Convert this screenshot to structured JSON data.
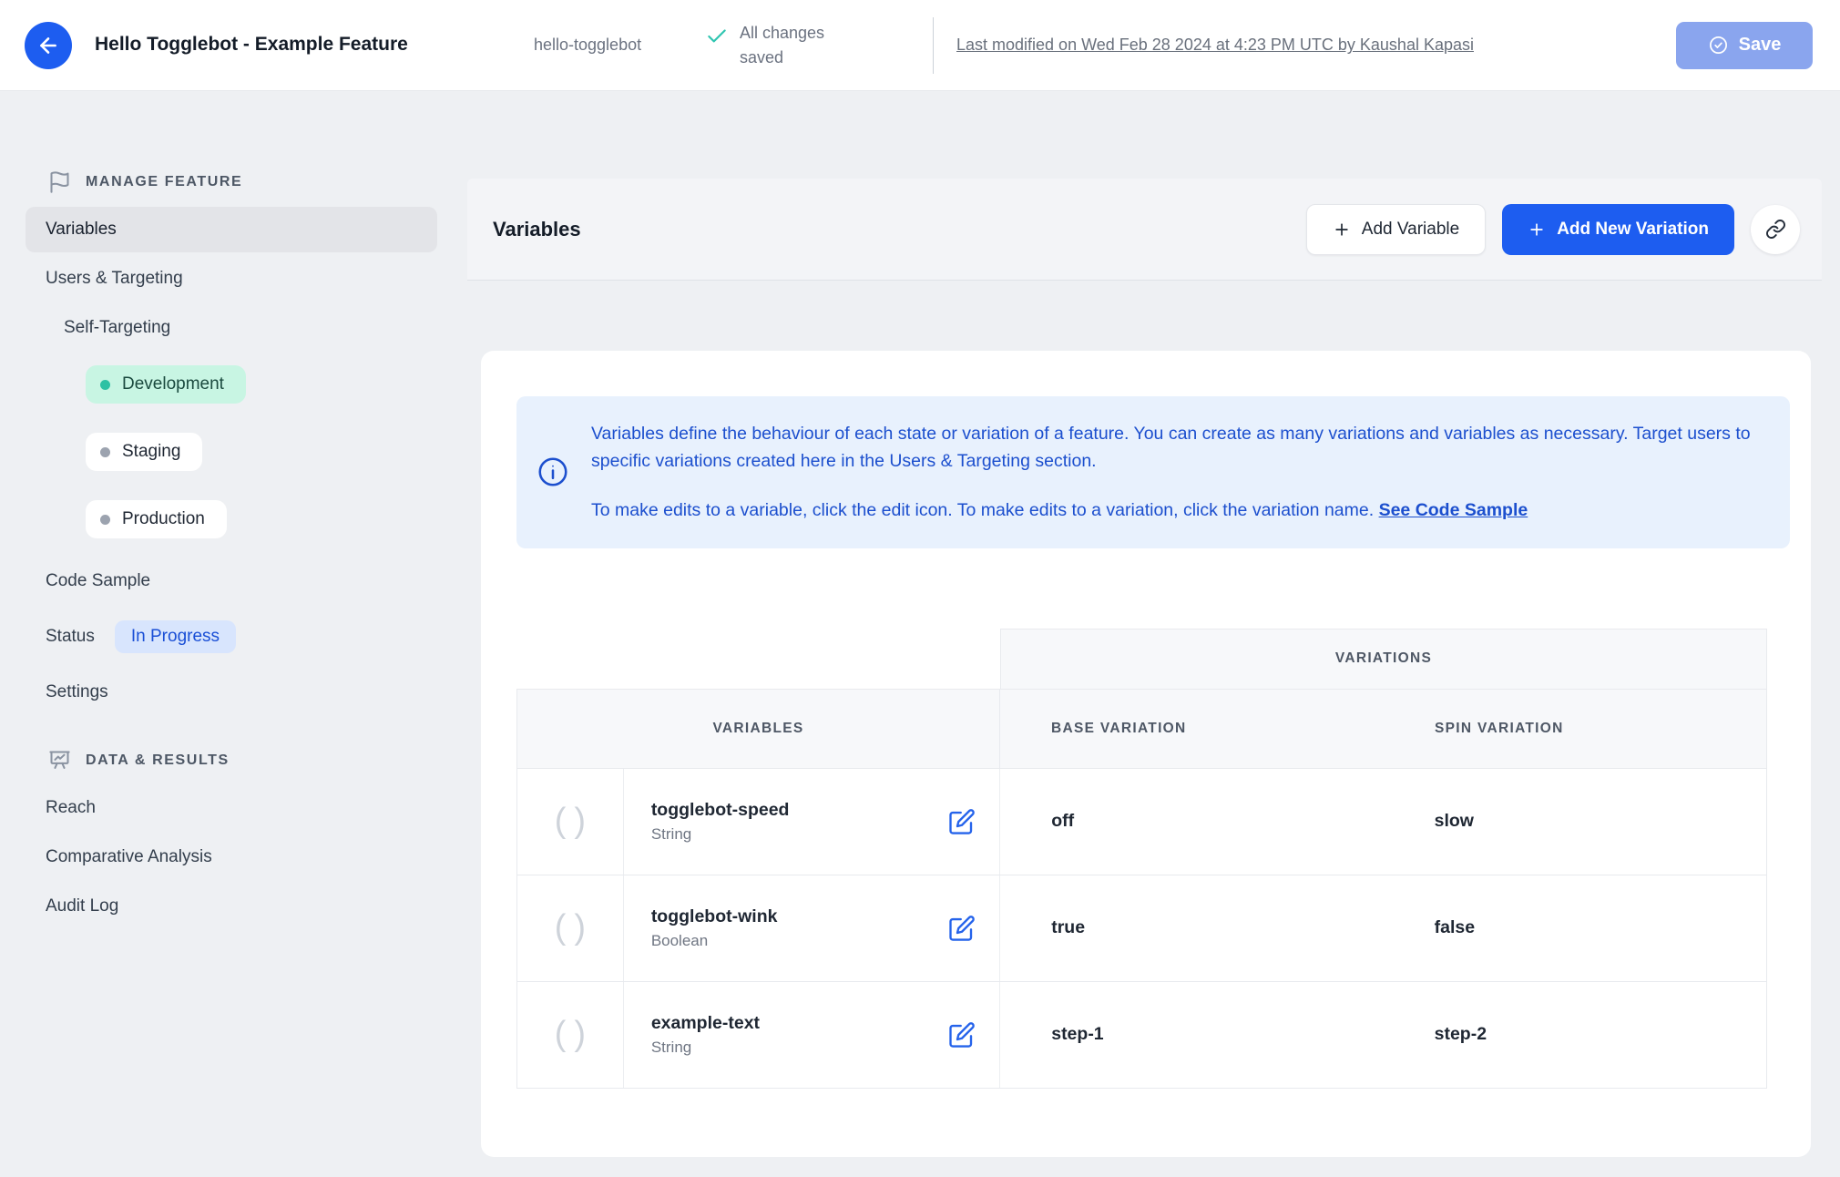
{
  "header": {
    "title": "Hello Togglebot - Example Feature",
    "feature_key": "hello-togglebot",
    "save_status": "All changes saved",
    "last_modified_link": "Last modified on Wed Feb 28 2024 at 4:23 PM UTC by Kaushal Kapasi",
    "save_button": "Save",
    "back_icon": "arrow-left-icon",
    "saved_check_icon": "check-icon",
    "accent_blue": "#1d5df0",
    "save_button_bg": "#8aa5ee",
    "check_teal": "#2ec5b0"
  },
  "sidebar": {
    "manage_section": {
      "label": "MANAGE FEATURE",
      "icon": "flag-icon"
    },
    "items": {
      "variables": "Variables",
      "users_targeting": "Users & Targeting",
      "self_targeting": "Self-Targeting",
      "code_sample": "Code Sample",
      "status_label": "Status",
      "status_badge": "In Progress",
      "settings": "Settings"
    },
    "environments": [
      {
        "label": "Development",
        "state": "active",
        "dot_color": "#2dc1a4",
        "bg": "#c8f5e3"
      },
      {
        "label": "Staging",
        "state": "inactive",
        "dot_color": "#9ca3af",
        "bg": "#ffffff"
      },
      {
        "label": "Production",
        "state": "inactive",
        "dot_color": "#9ca3af",
        "bg": "#ffffff"
      }
    ],
    "data_section": {
      "label": "DATA & RESULTS",
      "icon": "presentation-chart-icon"
    },
    "data_items": {
      "reach": "Reach",
      "comparative_analysis": "Comparative Analysis",
      "audit_log": "Audit Log"
    }
  },
  "toolbar": {
    "title": "Variables",
    "add_variable": "Add Variable",
    "add_new_variation": "Add New Variation",
    "link_icon": "link-icon",
    "primary_color": "#1d5df0"
  },
  "banner": {
    "icon": "info-icon",
    "paragraph1": "Variables define the behaviour of each state or variation of a feature. You can create as many variations and variables as necessary. Target users to specific variations created here in the Users & Targeting section.",
    "paragraph2": "To make edits to a variable, click the edit icon. To make edits to a variation, click the variation name.",
    "link": "See Code Sample",
    "text_color": "#1c4fce",
    "bg_color": "#e8f1fd"
  },
  "table": {
    "group_header": "VARIATIONS",
    "columns": {
      "variables": "VARIABLES",
      "base": "BASE VARIATION",
      "spin": "SPIN VARIATION"
    },
    "rows": [
      {
        "name": "togglebot-speed",
        "type": "String",
        "base": "off",
        "spin": "slow",
        "type_icon": "parentheses-icon",
        "edit_icon": "edit-pencil-icon"
      },
      {
        "name": "togglebot-wink",
        "type": "Boolean",
        "base": "true",
        "spin": "false",
        "type_icon": "parentheses-icon",
        "edit_icon": "edit-pencil-icon"
      },
      {
        "name": "example-text",
        "type": "String",
        "base": "step-1",
        "spin": "step-2",
        "type_icon": "parentheses-icon",
        "edit_icon": "edit-pencil-icon"
      }
    ]
  }
}
